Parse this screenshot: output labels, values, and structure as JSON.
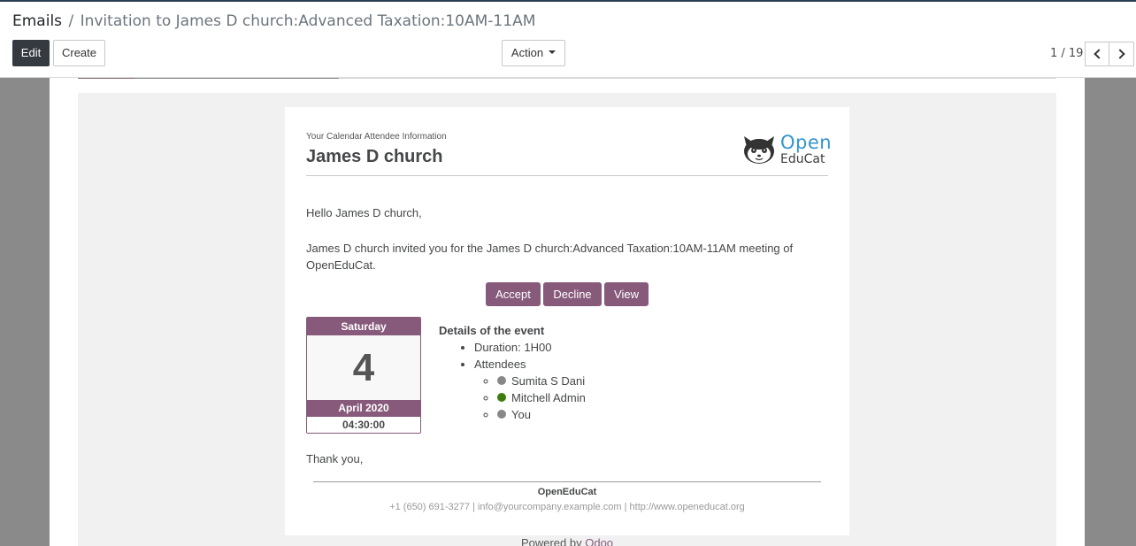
{
  "breadcrumb": {
    "root": "Emails",
    "separator": "/",
    "current": "Invitation to James D church:Advanced Taxation:10AM-11AM"
  },
  "toolbar": {
    "edit_label": "Edit",
    "create_label": "Create",
    "action_label": "Action"
  },
  "pager": {
    "value": "1 / 19"
  },
  "email": {
    "small_header": "Your Calendar Attendee Information",
    "recipient": "James D church",
    "logo_open": "Open",
    "logo_educat": "EduCat",
    "greeting": "Hello James D church,",
    "invite_text": "James D church invited you for the James D church:Advanced Taxation:10AM-11AM meeting of OpenEduCat.",
    "buttons": {
      "accept": "Accept",
      "decline": "Decline",
      "view": "View"
    },
    "calendar": {
      "weekday": "Saturday",
      "day": "4",
      "month_year": "April 2020",
      "time": "04:30:00"
    },
    "details": {
      "title": "Details of the event",
      "duration": "Duration: 1H00",
      "attendees_label": "Attendees",
      "attendees": [
        {
          "name": "Sumita S Dani",
          "color": "#888888"
        },
        {
          "name": "Mitchell Admin",
          "color": "#3c7d0d"
        },
        {
          "name": "You",
          "color": "#888888"
        }
      ]
    },
    "thanks": "Thank you,",
    "footer": {
      "company": "OpenEduCat",
      "contact": "+1 (650) 691-3277 | info@yourcompany.example.com | http://www.openeducat.org"
    },
    "powered_by": "Powered by",
    "powered_link": "Odoo"
  },
  "colors": {
    "accent": "#875a7b",
    "edit_button": "#343a40",
    "logo_blue": "#3394d0"
  }
}
